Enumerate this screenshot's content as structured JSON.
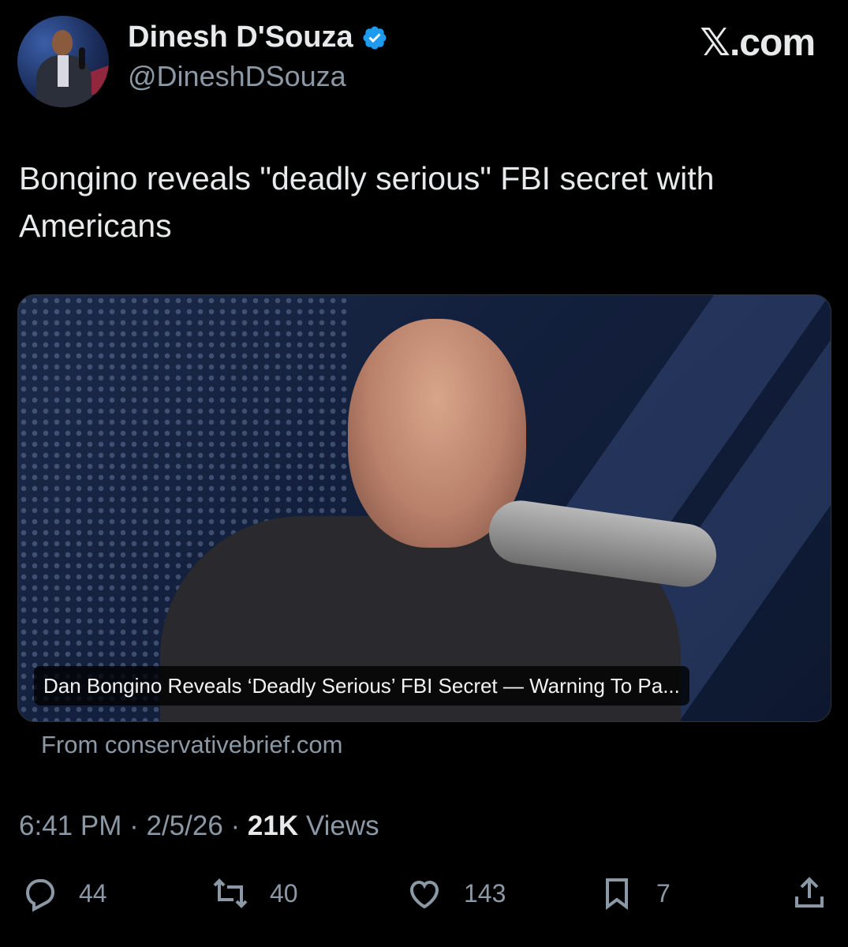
{
  "author": {
    "name": "Dinesh D'Souza",
    "handle": "@DineshDSouza",
    "verified": true
  },
  "brand": "𝕏.com",
  "tweet": {
    "text": "Bongino reveals \"deadly serious\" FBI secret with Americans"
  },
  "card": {
    "caption": "Dan Bongino Reveals ‘Deadly Serious’ FBI Secret — Warning To Pa...",
    "source": "From conservativebrief.com"
  },
  "meta": {
    "time": "6:41 PM",
    "date": "2/5/26",
    "views_count": "21K",
    "views_label": "Views"
  },
  "actions": {
    "replies": "44",
    "reposts": "40",
    "likes": "143",
    "bookmarks": "7"
  },
  "colors": {
    "background": "#000000",
    "text": "#e7e9ea",
    "muted": "#8b98a5",
    "verified": "#1d9bf0"
  }
}
